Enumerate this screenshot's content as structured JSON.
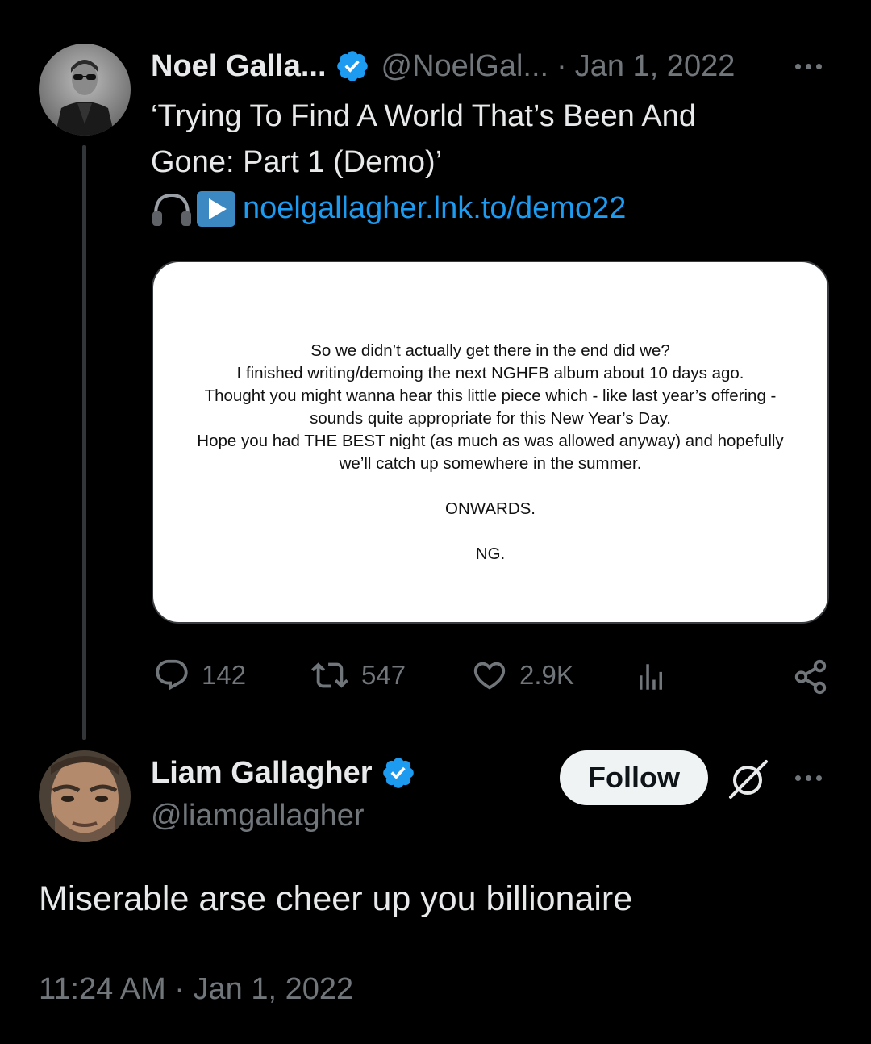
{
  "original_tweet": {
    "author_name": "Noel Galla...",
    "author_handle": "@NoelGal...",
    "separator": "·",
    "date": "Jan 1, 2022",
    "text_line1": "‘Trying To Find A World That’s Been And",
    "text_line2": "Gone: Part 1 (Demo)’",
    "emoji_prefix": "🎧▶️",
    "link": "noelgallagher.lnk.to/demo22",
    "image_letter": {
      "lines": [
        "So we didn’t actually get there in the end did we?",
        "I finished writing/demoing the next NGHFB album about 10 days ago.",
        "Thought you might wanna hear this little piece which - like last year’s offering -",
        "sounds quite appropriate for this New Year’s Day.",
        "Hope you had THE BEST night (as much as was allowed anyway) and hopefully",
        "we’ll catch up somewhere in the summer."
      ],
      "closing": "ONWARDS.",
      "signature": "NG."
    },
    "stats": {
      "replies": "142",
      "retweets": "547",
      "likes": "2.9K"
    }
  },
  "reply_tweet": {
    "author_name": "Liam Gallagher",
    "author_handle": "@liamgallagher",
    "follow_label": "Follow",
    "text": "Miserable arse cheer up you billionaire",
    "time": "11:24 AM",
    "separator": "·",
    "date": "Jan 1, 2022"
  },
  "colors": {
    "background": "#000000",
    "text": "#e7e9ea",
    "muted": "#71767b",
    "link": "#1d9bf0",
    "verified": "#1d9bf0"
  }
}
